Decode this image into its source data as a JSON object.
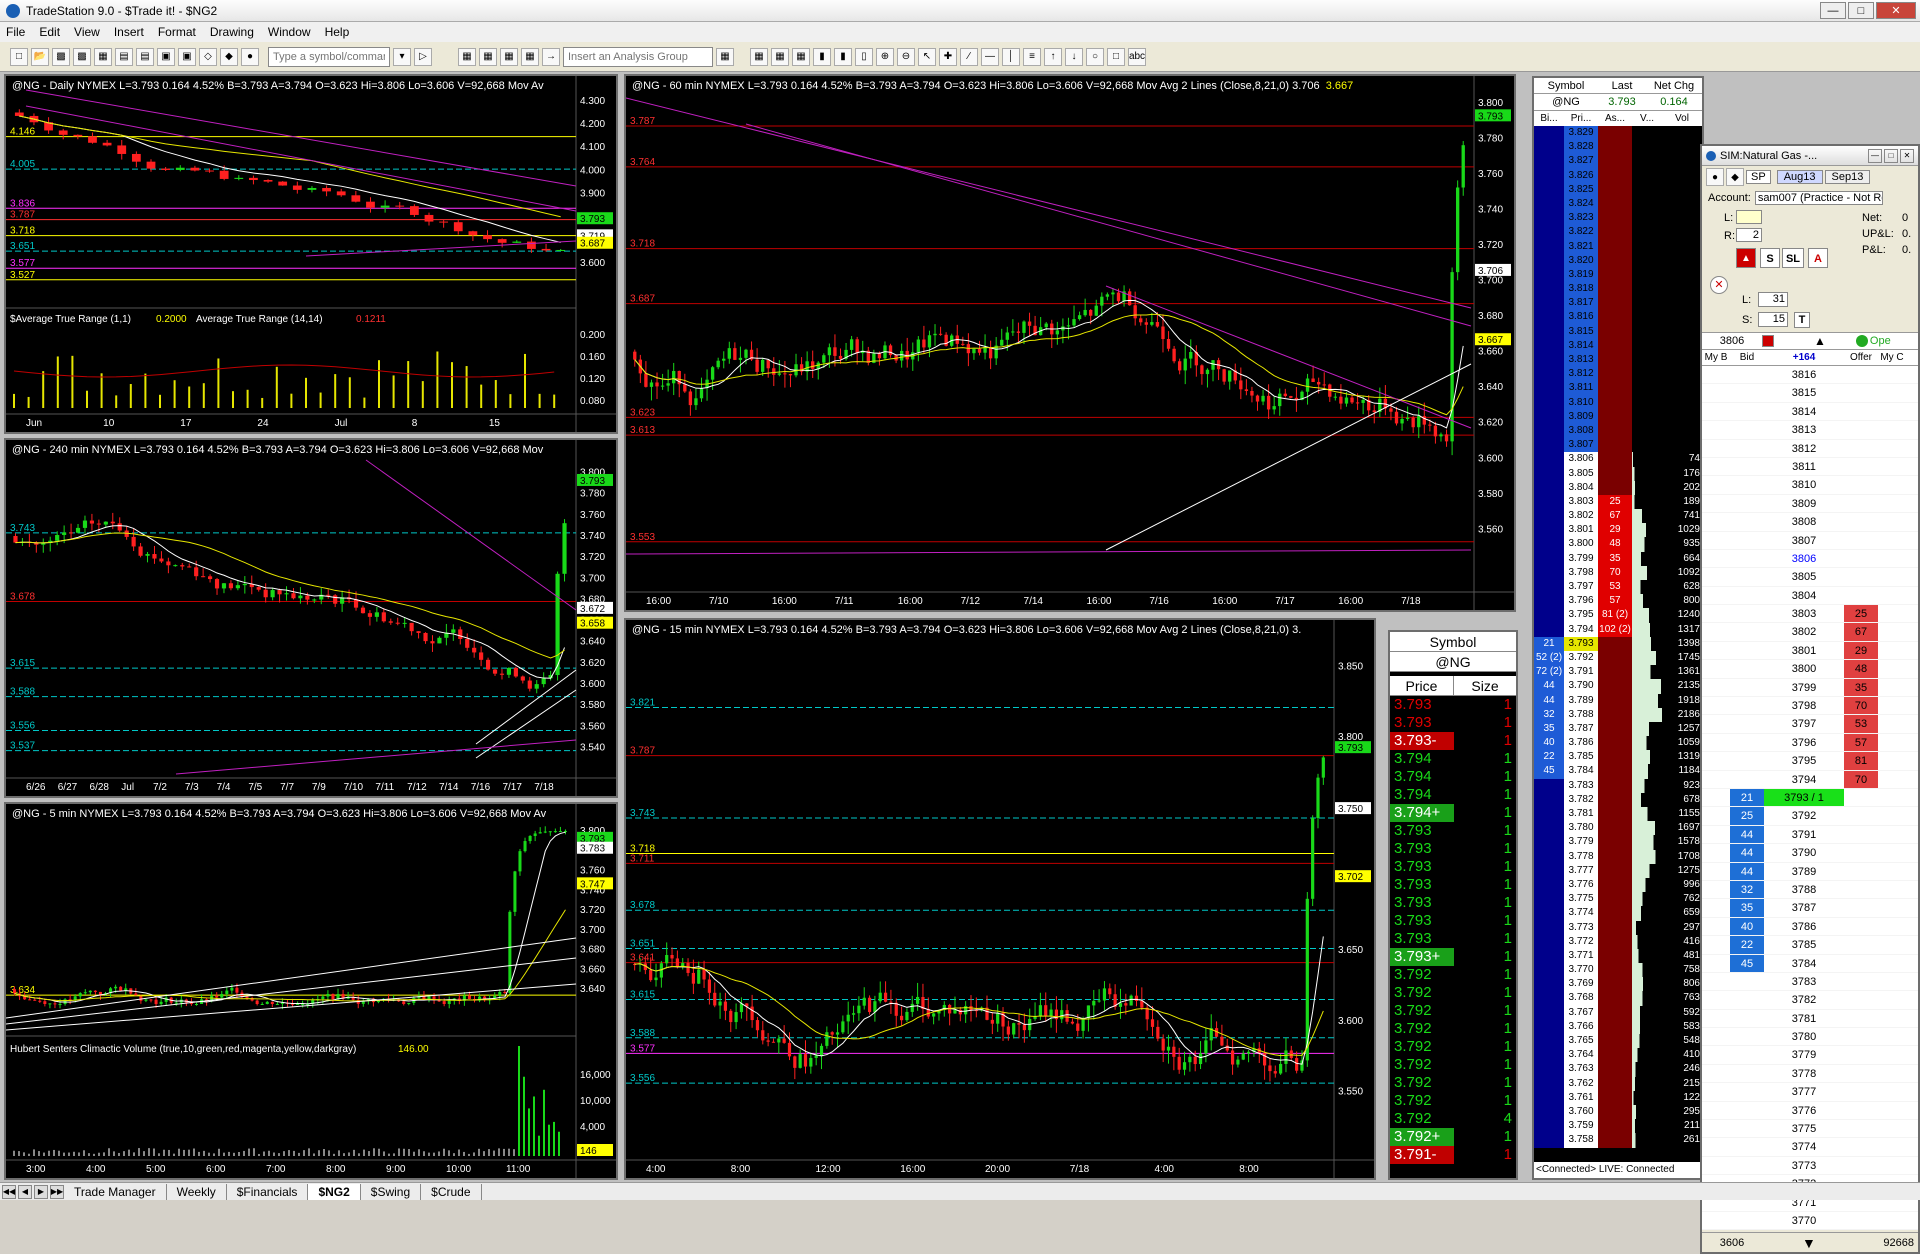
{
  "window": {
    "title": "TradeStation 9.0 - $Trade it! - $NG2"
  },
  "menu": [
    "File",
    "Edit",
    "View",
    "Insert",
    "Format",
    "Drawing",
    "Window",
    "Help"
  ],
  "toolbar": {
    "symbol_placeholder": "Type a symbol/command",
    "analysis_placeholder": "Insert an Analysis Group"
  },
  "daily": {
    "hdr": "@NG - Daily  NYMEX  L=3.793  0.164  4.52%  B=3.793  A=3.794  O=3.623  Hi=3.806  Lo=3.606  V=92,668  Mov Av",
    "ylabels": [
      "4.300",
      "4.200",
      "4.100",
      "4.000",
      "3.900",
      "3.800",
      "3.700",
      "3.600"
    ],
    "levels": [
      "4.146",
      "4.005",
      "3.836",
      "3.787",
      "3.718",
      "3.651",
      "3.577",
      "3.527"
    ],
    "tags": {
      "last": "3.793",
      "a": "3.719",
      "b": "3.687"
    },
    "atr_hdr": "$Average True Range (1,1)",
    "atr_val1": "0.2000",
    "atr_hdr2": "Average True Range (14,14)",
    "atr_val2": "0.1211",
    "atr_ylabels": [
      "0.200",
      "0.160",
      "0.120",
      "0.080"
    ],
    "xlabels": [
      "Jun",
      "10",
      "17",
      "24",
      "Jul",
      "8",
      "15"
    ]
  },
  "h240": {
    "hdr": "@NG - 240 min  NYMEX  L=3.793  0.164  4.52%  B=3.793  A=3.794  O=3.623  Hi=3.806  Lo=3.606  V=92,668  Mov",
    "ylabels": [
      "3.800",
      "3.780",
      "3.760",
      "3.740",
      "3.720",
      "3.700",
      "3.680",
      "3.660",
      "3.640",
      "3.620",
      "3.600",
      "3.580",
      "3.560",
      "3.540"
    ],
    "levels": [
      "3.743",
      "3.678",
      "3.615",
      "3.588",
      "3.556",
      "3.537"
    ],
    "tags": {
      "last": "3.793",
      "a": "3.672",
      "b": "3.658"
    },
    "xlabels": [
      "6/26",
      "6/27",
      "6/28",
      "Jul",
      "7/2",
      "7/3",
      "7/4",
      "7/5",
      "7/7",
      "7/9",
      "7/10",
      "7/11",
      "7/12",
      "7/14",
      "7/16",
      "7/17",
      "7/18"
    ]
  },
  "m5": {
    "hdr": "@NG - 5 min  NYMEX  L=3.793  0.164  4.52%  B=3.793  A=3.794  O=3.623  Hi=3.806  Lo=3.606  V=92,668  Mov Av",
    "ylabels": [
      "3.800",
      "3.780",
      "3.760",
      "3.740",
      "3.720",
      "3.700",
      "3.680",
      "3.660",
      "3.640"
    ],
    "levels": [
      "3.634"
    ],
    "tags": {
      "last": "3.793",
      "a": "3.783",
      "b": "3.747"
    },
    "vol_hdr": "Hubert Senters Climactic Volume (true,10,green,red,magenta,yellow,darkgray)",
    "vol_val": "146.00",
    "vol_ylabels": [
      "16,000",
      "10,000",
      "4,000"
    ],
    "vol_tag": "146",
    "xlabels": [
      "3:00",
      "4:00",
      "5:00",
      "6:00",
      "7:00",
      "8:00",
      "9:00",
      "10:00",
      "11:00"
    ]
  },
  "m60": {
    "hdr": "@NG - 60 min  NYMEX  L=3.793  0.164  4.52%  B=3.793  A=3.794  O=3.623  Hi=3.806  Lo=3.606  V=92,668  Mov Avg 2 Lines (Close,8,21,0)  3.706",
    "hdr_y": "3.667",
    "ylabels": [
      "3.800",
      "3.780",
      "3.760",
      "3.740",
      "3.720",
      "3.700",
      "3.680",
      "3.660",
      "3.640",
      "3.620",
      "3.600",
      "3.580",
      "3.560"
    ],
    "levels": [
      "3.787",
      "3.764",
      "3.718",
      "3.687",
      "3.623",
      "3.613",
      "3.553"
    ],
    "tags": {
      "last": "3.793",
      "a": "3.706",
      "b": "3.667"
    },
    "xlabels": [
      "16:00",
      "7/10",
      "16:00",
      "7/11",
      "16:00",
      "7/12",
      "7/14",
      "16:00",
      "7/16",
      "16:00",
      "7/17",
      "16:00",
      "7/18"
    ]
  },
  "m15": {
    "hdr": "@NG - 15 min  NYMEX  L=3.793  0.164  4.52%  B=3.793  A=3.794  O=3.623  Hi=3.806  Lo=3.606  V=92,668  Mov Avg 2 Lines (Close,8,21,0)  3.",
    "ylabels": [
      "3.850",
      "3.800",
      "3.750",
      "3.700",
      "3.650",
      "3.600",
      "3.550"
    ],
    "levels": [
      "3.821",
      "3.787",
      "3.743",
      "3.718",
      "3.711",
      "3.678",
      "3.651",
      "3.641",
      "3.615",
      "3.588",
      "3.577",
      "3.556"
    ],
    "tags": {
      "last": "3.793",
      "a": "3.750",
      "b": "3.702"
    },
    "xlabels": [
      "4:00",
      "8:00",
      "12:00",
      "16:00",
      "20:00",
      "7/18",
      "4:00",
      "8:00"
    ]
  },
  "timesales": {
    "symbol_label": "Symbol",
    "symbol": "@NG",
    "col_price": "Price",
    "col_size": "Size",
    "rows": [
      {
        "p": "3.793",
        "s": "1",
        "c": "red"
      },
      {
        "p": "3.793",
        "s": "1",
        "c": "red"
      },
      {
        "p": "3.793-",
        "s": "1",
        "c": "redbg"
      },
      {
        "p": "3.794",
        "s": "1",
        "c": "green"
      },
      {
        "p": "3.794",
        "s": "1",
        "c": "green"
      },
      {
        "p": "3.794",
        "s": "1",
        "c": "green"
      },
      {
        "p": "3.794+",
        "s": "1",
        "c": "greenbg"
      },
      {
        "p": "3.793",
        "s": "1",
        "c": "green"
      },
      {
        "p": "3.793",
        "s": "1",
        "c": "green"
      },
      {
        "p": "3.793",
        "s": "1",
        "c": "green"
      },
      {
        "p": "3.793",
        "s": "1",
        "c": "green"
      },
      {
        "p": "3.793",
        "s": "1",
        "c": "green"
      },
      {
        "p": "3.793",
        "s": "1",
        "c": "green"
      },
      {
        "p": "3.793",
        "s": "1",
        "c": "green"
      },
      {
        "p": "3.793+",
        "s": "1",
        "c": "greenbg"
      },
      {
        "p": "3.792",
        "s": "1",
        "c": "green"
      },
      {
        "p": "3.792",
        "s": "1",
        "c": "green"
      },
      {
        "p": "3.792",
        "s": "1",
        "c": "green"
      },
      {
        "p": "3.792",
        "s": "1",
        "c": "green"
      },
      {
        "p": "3.792",
        "s": "1",
        "c": "green"
      },
      {
        "p": "3.792",
        "s": "1",
        "c": "green"
      },
      {
        "p": "3.792",
        "s": "1",
        "c": "green"
      },
      {
        "p": "3.792",
        "s": "1",
        "c": "green"
      },
      {
        "p": "3.792",
        "s": "4",
        "c": "green"
      },
      {
        "p": "3.792+",
        "s": "1",
        "c": "greenbg"
      },
      {
        "p": "3.791-",
        "s": "1",
        "c": "redbg"
      }
    ]
  },
  "matrix": {
    "cols": [
      "Symbol",
      "Last",
      "Net Chg"
    ],
    "symbol": "@NG",
    "last": "3.793",
    "chg": "0.164",
    "sub_cols": [
      "Bi...",
      "Pri...",
      "As...",
      "V...",
      "Vol"
    ],
    "status": "<Connected> LIVE: Connected",
    "prices": [
      "3.829",
      "3.828",
      "3.827",
      "3.826",
      "3.825",
      "3.824",
      "3.823",
      "3.822",
      "3.821",
      "3.820",
      "3.819",
      "3.818",
      "3.817",
      "3.816",
      "3.815",
      "3.814",
      "3.813",
      "3.812",
      "3.811",
      "3.810",
      "3.809",
      "3.808",
      "3.807",
      "3.806",
      "3.805",
      "3.804",
      "3.803",
      "3.802",
      "3.801",
      "3.800",
      "3.799",
      "3.798",
      "3.797",
      "3.796",
      "3.795",
      "3.794",
      "3.793",
      "3.792",
      "3.791",
      "3.790",
      "3.789",
      "3.788",
      "3.787",
      "3.786",
      "3.785",
      "3.784",
      "3.783",
      "3.782",
      "3.781",
      "3.780",
      "3.779",
      "3.778",
      "3.777",
      "3.776",
      "3.775",
      "3.774",
      "3.773",
      "3.772",
      "3.771",
      "3.770",
      "3.769",
      "3.768",
      "3.767",
      "3.766",
      "3.765",
      "3.764",
      "3.763",
      "3.762",
      "3.761",
      "3.760",
      "3.759",
      "3.758"
    ],
    "asks": {
      "3.803": "25",
      "3.802": "67",
      "3.801": "29",
      "3.800": "48",
      "3.799": "35",
      "3.798": "70",
      "3.797": "53",
      "3.796": "57",
      "3.795": "81 (2)",
      "3.794": "102 (2)"
    },
    "bids": {
      "3.793": "21",
      "3.792": "52 (2)",
      "3.791": "72 (2)",
      "3.790": "44",
      "3.789": "44",
      "3.788": "32",
      "3.787": "35",
      "3.786": "40",
      "3.785": "22",
      "3.784": "45"
    },
    "vols": {
      "3.806": "74",
      "3.805": "176",
      "3.804": "202",
      "3.803": "189",
      "3.802": "741",
      "3.801": "1029",
      "3.800": "935",
      "3.799": "664",
      "3.798": "1092",
      "3.797": "628",
      "3.796": "800",
      "3.795": "1240",
      "3.794": "1317",
      "3.793": "1398",
      "3.792": "1745",
      "3.791": "1361",
      "3.790": "2135",
      "3.789": "1918",
      "3.788": "2186",
      "3.787": "1257",
      "3.786": "1059",
      "3.785": "1319",
      "3.784": "1184",
      "3.783": "923",
      "3.782": "678",
      "3.781": "1155",
      "3.780": "1697",
      "3.779": "1578",
      "3.778": "1708",
      "3.777": "1275",
      "3.776": "996",
      "3.775": "762",
      "3.774": "659",
      "3.773": "297",
      "3.772": "416",
      "3.771": "481",
      "3.770": "758",
      "3.769": "806",
      "3.768": "763",
      "3.767": "592",
      "3.766": "583",
      "3.765": "548",
      "3.764": "410",
      "3.763": "246",
      "3.762": "215",
      "3.761": "122",
      "3.760": "295",
      "3.759": "211",
      "3.758": "261"
    }
  },
  "sim": {
    "title": "SIM:Natural Gas -...",
    "combo1": "SP",
    "tab1": "Aug13",
    "tab2": "Sep13",
    "account_label": "Account:",
    "account": "sam007 (Practice - Not Revie",
    "l_label": "L:",
    "r_label": "R:",
    "r_val": "2",
    "net_label": "Net:",
    "net": "0",
    "upl_label": "UP&L:",
    "upl": "0.",
    "pl_label": "P&L:",
    "pl": "0.",
    "l2_label": "L:",
    "l2": "31",
    "s_label": "S:",
    "s": "15",
    "last_price": "3806",
    "open_label": "Ope",
    "cols": [
      "My B",
      "Bid",
      "+164",
      "Offer",
      "My C"
    ],
    "ladder": [
      "3816",
      "3815",
      "3814",
      "3813",
      "3812",
      "3811",
      "3810",
      "3809",
      "3808",
      "3807",
      "3806",
      "3805",
      "3804",
      "3803",
      "3802",
      "3801",
      "3800",
      "3799",
      "3798",
      "3797",
      "3796",
      "3795",
      "3794",
      "3793 / 1",
      "3792",
      "3791",
      "3790",
      "3789",
      "3788",
      "3787",
      "3786",
      "3785",
      "3784",
      "3783",
      "3782",
      "3781",
      "3780",
      "3779",
      "3778",
      "3777",
      "3776",
      "3775",
      "3774",
      "3773",
      "3772",
      "3771",
      "3770"
    ],
    "offers": {
      "3803": "25",
      "3802": "67",
      "3801": "29",
      "3800": "48",
      "3799": "35",
      "3798": "70",
      "3797": "53",
      "3796": "57",
      "3795": "81",
      "3794": "70"
    },
    "bids": {
      "3793 / 1": "21",
      "3792": "25",
      "3791": "44",
      "3790": "44",
      "3789": "44",
      "3788": "32",
      "3787": "35",
      "3786": "40",
      "3785": "22",
      "3784": "45"
    },
    "bottom_left": "3606",
    "bottom_right": "92668"
  },
  "tabs": [
    "Trade Manager",
    "Weekly",
    "$Financials",
    "$NG2",
    "$Swing",
    "$Crude"
  ]
}
